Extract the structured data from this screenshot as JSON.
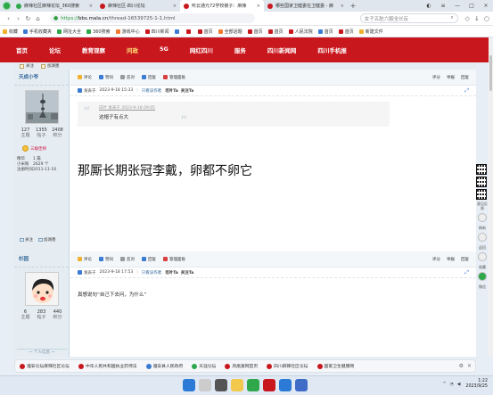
{
  "browser": {
    "tabs": [
      {
        "title": "麻辣社区麻辣论坛_360搜索",
        "color": "#2ea84a",
        "active": false
      },
      {
        "title": "麻辣社区-四川论坛",
        "color": "#c8171d",
        "active": false
      },
      {
        "title": "听云通元72学校被子：麻辣",
        "color": "#c8171d",
        "active": true
      },
      {
        "title": "哪些国家卫健委在卫健委 - 麻",
        "color": "#c8171d",
        "active": false
      }
    ],
    "url": {
      "proto": "https://",
      "host": "bbs.mala.cn",
      "path": "/thread-16539725-1-1.html"
    },
    "search_placeholder": "女子五脏六腑全长反",
    "bookmarks": [
      {
        "label": "收藏",
        "color": "#f0b030"
      },
      {
        "label": "手机收藏夹",
        "color": "#3b7bd1"
      },
      {
        "label": "网址大全",
        "color": "#2ea84a"
      },
      {
        "label": "360搜索",
        "color": "#2ea84a"
      },
      {
        "label": "游戏中心",
        "color": "#f07a30"
      },
      {
        "label": "四川新闻",
        "color": "#c8171d"
      },
      {
        "label": "",
        "color": "#3b7bd1"
      },
      {
        "label": "",
        "color": "#c8171d"
      },
      {
        "label": "首页",
        "color": "#c8171d"
      },
      {
        "label": "全部话题",
        "color": "#f07a30"
      },
      {
        "label": "首页",
        "color": "#c8171d"
      },
      {
        "label": "首页",
        "color": "#c8171d"
      },
      {
        "label": "人民法院",
        "color": "#c8171d"
      },
      {
        "label": "首页",
        "color": "#3b7bd1"
      },
      {
        "label": "首页",
        "color": "#c8171d"
      },
      {
        "label": "新建文件",
        "color": "#f0b030"
      }
    ]
  },
  "site_nav": [
    "首页",
    "论坛",
    "教育观察",
    "问政",
    "5G",
    "网红四川",
    "服务",
    "四川新闻网",
    "四川手机报"
  ],
  "top_row": [
    "关注",
    "加湖墨"
  ],
  "post1": {
    "author": "天成小爷",
    "stats": [
      {
        "num": "127",
        "lab": "主题"
      },
      {
        "num": "1355",
        "lab": "帖子"
      },
      {
        "num": "2408",
        "lab": "积分"
      }
    ],
    "badge": "三级佳师",
    "info": [
      {
        "k": "精华",
        "v": "1 篇"
      },
      {
        "k": "小米粉",
        "v": "2629 个"
      },
      {
        "k": "注册时间",
        "v": "2011-11-16"
      }
    ],
    "side_buttons": [
      "关注",
      "加湖墨"
    ],
    "actions": [
      "评论",
      "赞同",
      "反对",
      "回复",
      "管理面板"
    ],
    "right_actions": [
      "评分",
      "举报",
      "回复"
    ],
    "meta": {
      "prefix": "发表于",
      "time": "2023-9-18 15:33",
      "view_author": "只看该作者",
      "act1": "坦叶Ta",
      "act2": "关注Ta"
    },
    "quote_head": "白叶 发表于 2023-9-18 09:05",
    "quote_text": "这帽子有点大",
    "body": "那厮长期张冠李戴，卵都不卵它"
  },
  "post2": {
    "author": "杉园",
    "stats": [
      {
        "num": "6",
        "lab": "主题"
      },
      {
        "num": "283",
        "lab": "帖子"
      },
      {
        "num": "440",
        "lab": "积分"
      }
    ],
    "rank_label": "一 个人信息 一",
    "actions": [
      "评论",
      "赞同",
      "反对",
      "回复",
      "管理面板"
    ],
    "right_actions": [
      "评分",
      "举报",
      "回复"
    ],
    "meta": {
      "prefix": "发表于",
      "time": "2023-9-18 17:53",
      "view_author": "只看该作者",
      "act1": "坦叶Ta",
      "act2": "关注Ta"
    },
    "body": "真想说句“自己下去问，为什么”"
  },
  "bottom_bookmarks": [
    {
      "label": "遵安论坛麻辣社区论坛",
      "color": "#c8171d"
    },
    {
      "label": "中华人民共和国执业药师法",
      "color": "#c8171d"
    },
    {
      "label": "遵安县人民政府",
      "color": "#3b7bd1"
    },
    {
      "label": "天涯论坛",
      "color": "#2ea84a"
    },
    {
      "label": "凤凰富网首页",
      "color": "#c8171d"
    },
    {
      "label": "四川麻辣社区论坛",
      "color": "#c8171d"
    },
    {
      "label": "国家卫生健康网",
      "color": "#c8171d"
    }
  ],
  "rail": [
    "意见反馈",
    "刷新",
    "返回",
    "收藏",
    "微信"
  ],
  "taskbar": {
    "time": "1:22",
    "date": "2023/9/25"
  }
}
